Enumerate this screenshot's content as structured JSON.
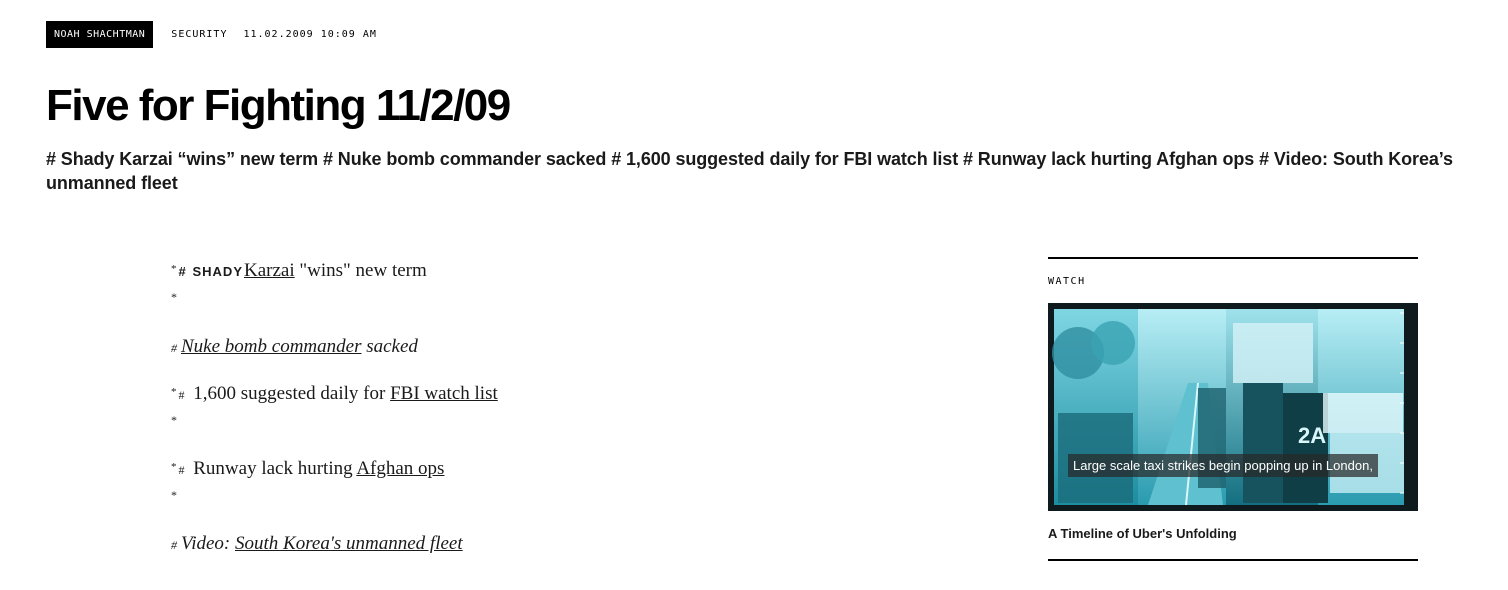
{
  "byline": {
    "author": "NOAH SHACHTMAN",
    "category": "SECURITY",
    "datetime": "11.02.2009 10:09 AM"
  },
  "article": {
    "title": "Five for Fighting 11/2/09",
    "dek": "# Shady Karzai “wins” new term # Nuke bomb commander sacked # 1,600 suggested daily for FBI watch list # Runway lack hurting Afghan ops # Video: South Korea’s unmanned fleet"
  },
  "body": {
    "items": [
      {
        "prefix": "*",
        "hash": "#",
        "lead": "SHADY",
        "link": "Karzai",
        "after": " \"wins\" new term",
        "star": "*"
      },
      {
        "hash": "#",
        "link": "Nuke bomb commander",
        "after": " sacked"
      },
      {
        "prefix": "*",
        "hash": "#",
        "before": " 1,600 suggested daily for ",
        "link": "FBI watch list",
        "star": "*"
      },
      {
        "prefix": "*",
        "hash": "#",
        "before": " Runway lack hurting ",
        "link": "Afghan ops",
        "star": "*"
      },
      {
        "hash": "#",
        "before": "Video: ",
        "link": "South Korea's unmanned fleet"
      }
    ]
  },
  "sidebar": {
    "section_label": "WATCH",
    "video_caption": "Large scale taxi strikes begin popping up in London,",
    "video_title": "A Timeline of Uber's Unfolding"
  },
  "colors": {
    "video_tint": "#1fb3c9",
    "badge_bg": "#000000"
  }
}
